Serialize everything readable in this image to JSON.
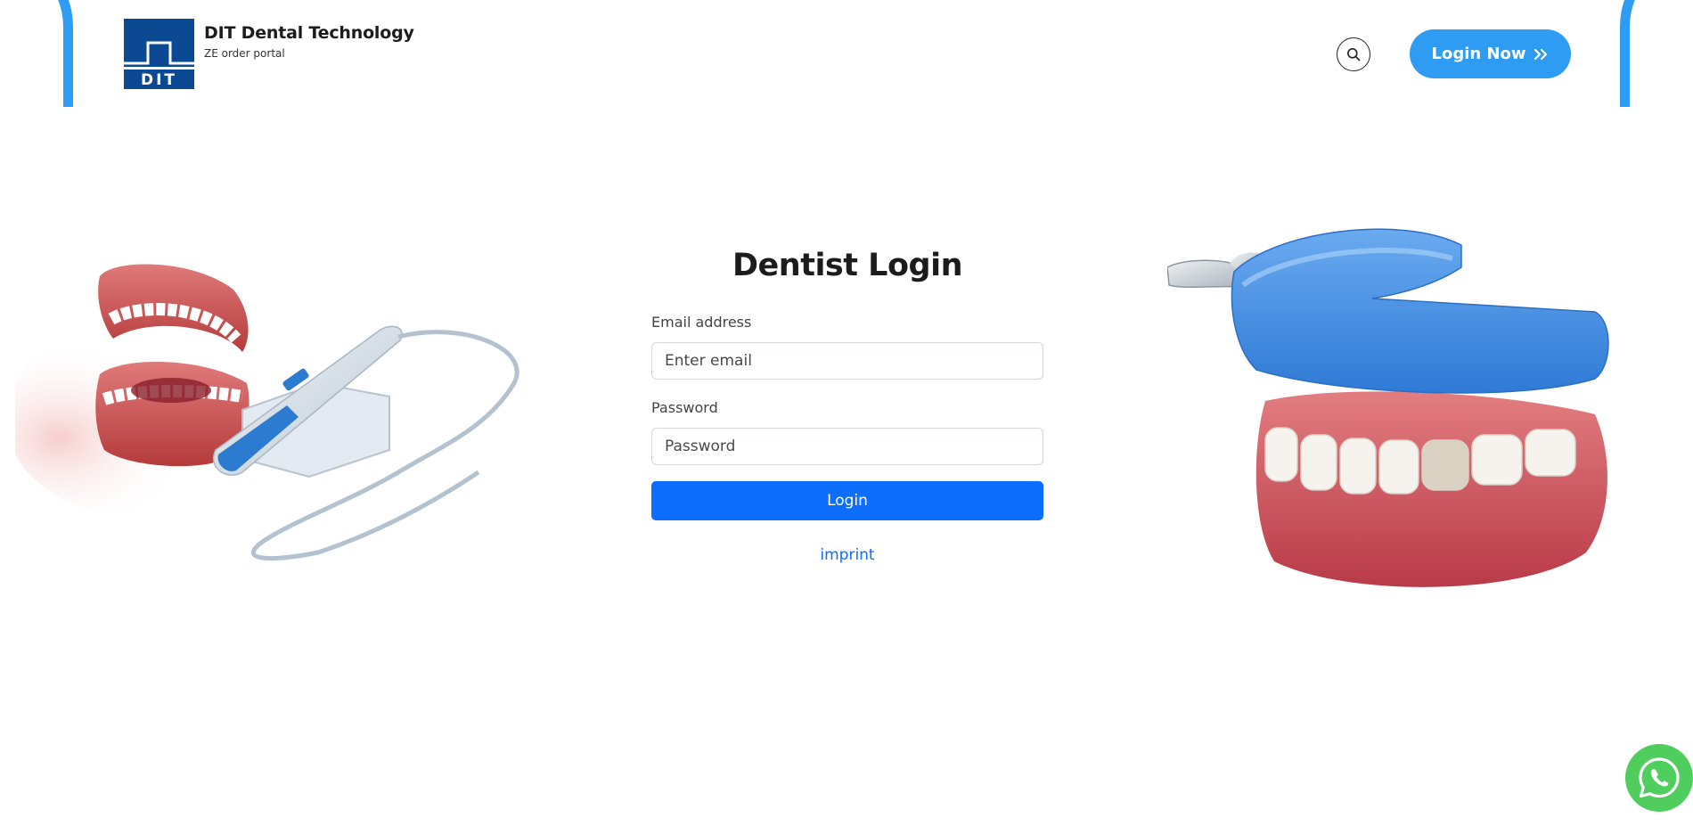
{
  "header": {
    "logo_text": "DIT",
    "brand_name": "DIT Dental Technology",
    "brand_subtitle": "ZE order portal",
    "search_icon": "search-icon",
    "login_now_label": "Login Now",
    "login_now_icon": "double-chevron-right-icon"
  },
  "login": {
    "title": "Dentist Login",
    "email_label": "Email address",
    "email_placeholder": "Enter email",
    "email_value": "",
    "password_label": "Password",
    "password_placeholder": "Password",
    "password_value": "",
    "submit_label": "Login",
    "imprint_label": "imprint"
  },
  "illustrations": {
    "left": "dental-jaw-with-intraoral-scanner-image",
    "right": "dental-impression-tray-on-lower-jaw-image"
  },
  "floating": {
    "whatsapp_icon": "whatsapp-icon"
  },
  "colors": {
    "accent": "#2e9cf2",
    "primary_button": "#0d6efd",
    "logo_bg": "#0b4a93",
    "whatsapp": "#4fce5d"
  }
}
